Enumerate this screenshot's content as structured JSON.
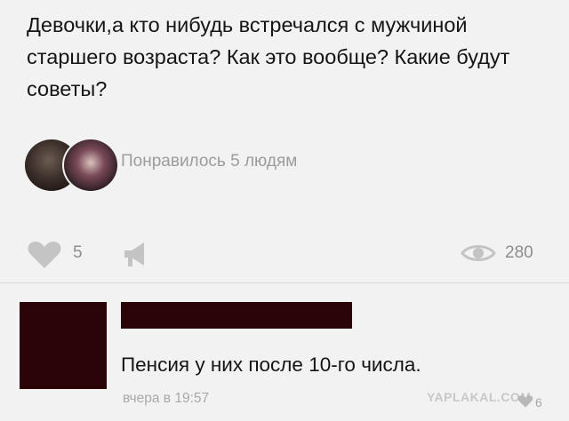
{
  "post": {
    "text": "Девочки,а кто нибудь встречался с мужчиной старшего возраста? Как это вообще? Какие будут советы?"
  },
  "likers": {
    "label": "Понравилось 5 людям"
  },
  "stats": {
    "likes": "5",
    "views": "280",
    "icons": [
      "heart-icon",
      "megaphone-share-icon",
      "eye-icon"
    ],
    "icon_color": "#c4c4c4"
  },
  "comment": {
    "text": "Пенсия у них после 10-го числа.",
    "time": "вчера в 19:57",
    "likes": "6",
    "redaction_color": "#2a0406"
  },
  "watermark": "YAPLAKAL.COM"
}
